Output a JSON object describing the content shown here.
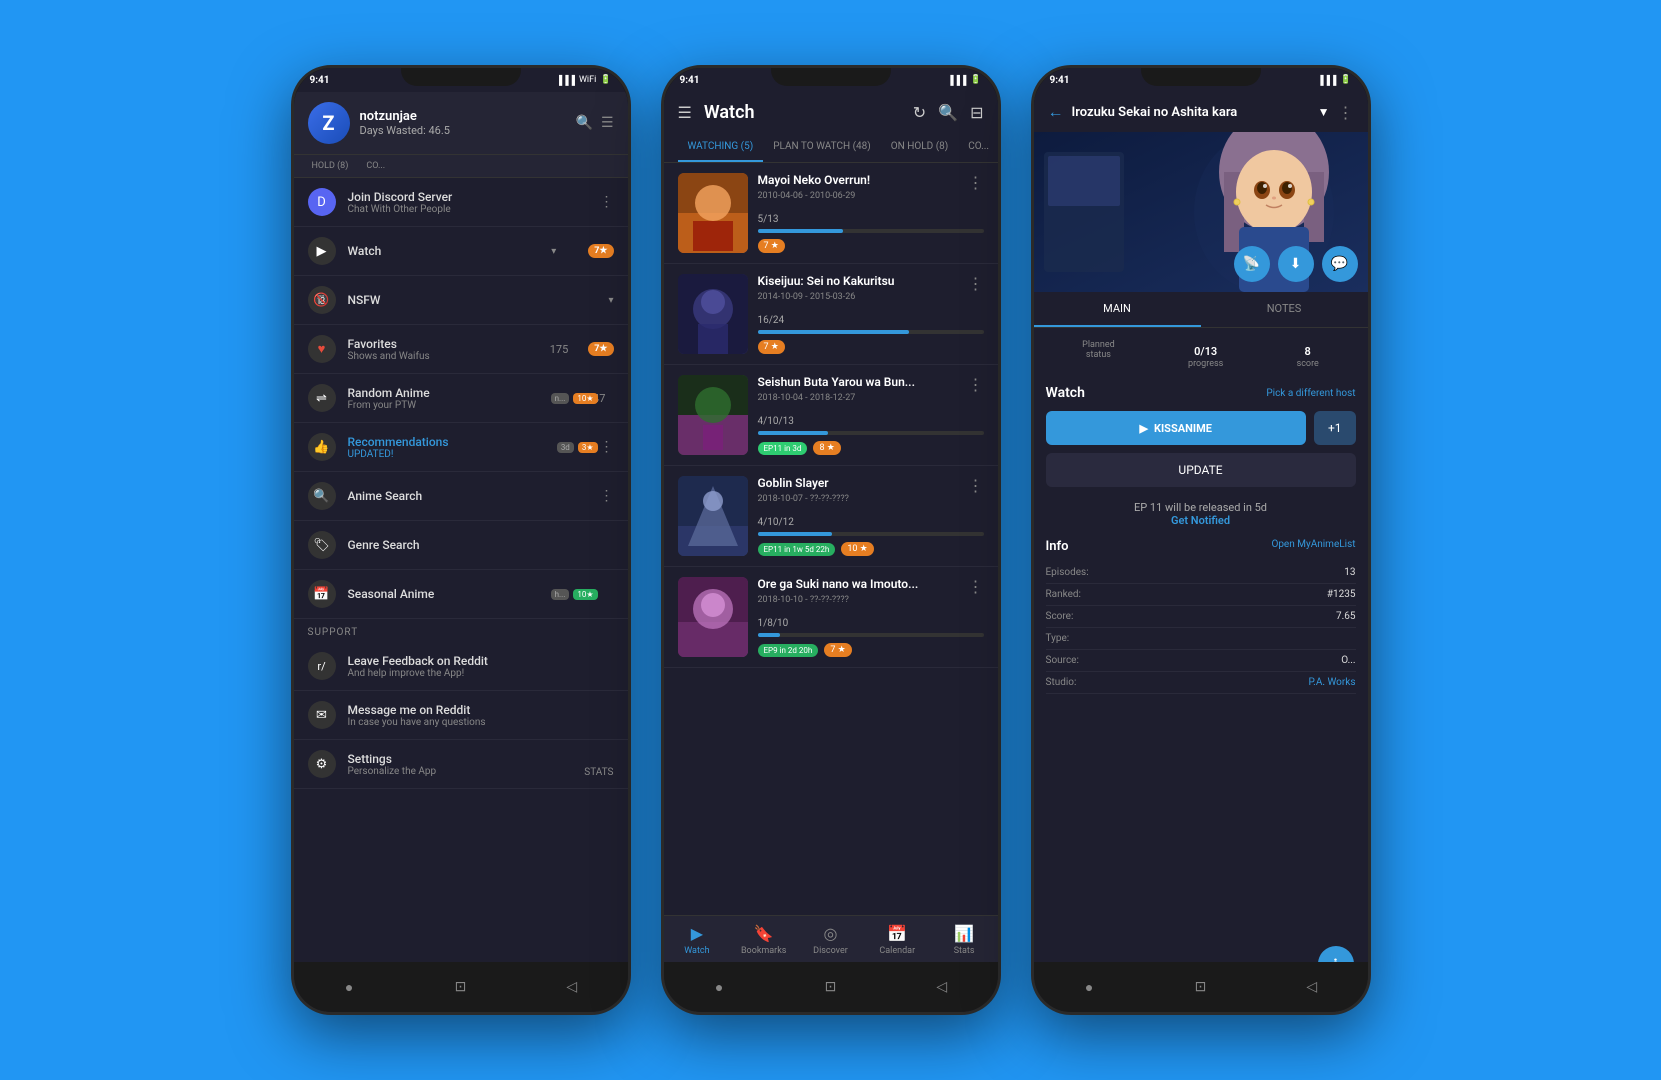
{
  "bg_color": "#2196F3",
  "phone1": {
    "header": {
      "avatar_letter": "Z",
      "username": "notzunjae",
      "days_label": "Days Wasted: 46.5"
    },
    "tabs": [
      "HOLD (8)",
      "CO..."
    ],
    "menu_items": [
      {
        "id": "discord",
        "icon_type": "discord",
        "label": "Join Discord Server",
        "sub": "Chat With Other People",
        "has_more": true
      },
      {
        "id": "watch",
        "icon_type": "watch",
        "label": "Watch",
        "has_chevron": true,
        "badge": "7★"
      },
      {
        "id": "nsfw",
        "icon_type": "nsfw",
        "label": "NSFW",
        "has_chevron": true
      },
      {
        "id": "favorites",
        "icon_type": "fav",
        "label": "Favorites",
        "sub": "Shows and Waifus",
        "count": "175",
        "badge": "7★"
      },
      {
        "id": "random",
        "icon_type": "random",
        "label": "Random Anime",
        "sub": "From your PTW",
        "count": "47",
        "mini_badges": [
          "n...",
          "10★"
        ]
      },
      {
        "id": "recommendations",
        "icon_type": "rec",
        "label": "Recommendations",
        "sub": "UPDATED!",
        "label_blue": true,
        "sub_color": "#3498db",
        "mini_badges": [
          "3d",
          "3★"
        ]
      },
      {
        "id": "anime-search",
        "icon_type": "search",
        "label": "Anime Search",
        "has_more": true
      },
      {
        "id": "genre-search",
        "icon_type": "genre",
        "label": "Genre Search"
      },
      {
        "id": "seasonal",
        "icon_type": "seasonal",
        "label": "Seasonal Anime",
        "mini_badges": [
          "h...",
          "10★"
        ]
      }
    ],
    "support_label": "Support",
    "support_items": [
      {
        "id": "reddit-feedback",
        "label": "Leave Feedback on Reddit",
        "sub": "And help improve the App!"
      },
      {
        "id": "reddit-message",
        "label": "Message me on Reddit",
        "sub": "In case you have any questions"
      }
    ],
    "settings": {
      "label": "Settings",
      "sub": "Personalize the App"
    }
  },
  "phone2": {
    "header": {
      "title": "Watch"
    },
    "tabs": [
      {
        "id": "watching",
        "label": "WATCHING (5)",
        "active": true
      },
      {
        "id": "plan",
        "label": "PLAN TO WATCH (48)",
        "active": false
      },
      {
        "id": "hold",
        "label": "ON HOLD (8)",
        "active": false
      },
      {
        "id": "completed",
        "label": "CO...",
        "active": false
      }
    ],
    "anime_list": [
      {
        "id": "mayoi",
        "title": "Mayoi Neko Overrun!",
        "dates": "2010-04-06 - 2010-06-29",
        "progress": "5/13",
        "progress_pct": 38,
        "thumb_class": "thumb-mayoi",
        "score": "7★",
        "ep_badge": null
      },
      {
        "id": "kiseijuu",
        "title": "Kiseijuu: Sei no Kakuritsu",
        "dates": "2014-10-09 - 2015-03-26",
        "progress": "16/24",
        "progress_pct": 67,
        "thumb_class": "thumb-kiseijuu",
        "score": "7★",
        "ep_badge": null
      },
      {
        "id": "seishun",
        "title": "Seishun Buta Yarou wa Bun...",
        "dates": "2018-10-04 - 2018-12-27",
        "progress": "4/10/13",
        "progress_pct": 31,
        "thumb_class": "thumb-seishun",
        "score": "8★",
        "ep_badge": "EP11 in 3d"
      },
      {
        "id": "goblin",
        "title": "Goblin Slayer",
        "dates": "2018-10-07 - ??-??-????",
        "progress": "4/10/12",
        "progress_pct": 33,
        "thumb_class": "thumb-goblin",
        "score": "10★",
        "ep_badge": "EP11 in 1w 5d 22h"
      },
      {
        "id": "ore",
        "title": "Ore ga Suki nano wa Imouto...",
        "dates": "2018-10-10 - ??-??-????",
        "progress": "1/8/10",
        "progress_pct": 10,
        "thumb_class": "thumb-ore",
        "score": "7★",
        "ep_badge": "EP9 in 2d 20h"
      }
    ],
    "nav_items": [
      {
        "id": "watch",
        "label": "Watch",
        "icon": "▶",
        "active": true
      },
      {
        "id": "bookmarks",
        "label": "Bookmarks",
        "icon": "🔖",
        "active": false
      },
      {
        "id": "discover",
        "label": "Discover",
        "icon": "◎",
        "active": false
      },
      {
        "id": "calendar",
        "label": "Calendar",
        "icon": "📅",
        "active": false
      },
      {
        "id": "stats",
        "label": "Stats",
        "icon": "📊",
        "active": false
      }
    ]
  },
  "phone3": {
    "header": {
      "title": "Irozuku Sekai no Ashita kara",
      "dropdown": "▼"
    },
    "tabs": [
      {
        "id": "main",
        "label": "MAIN",
        "active": true
      },
      {
        "id": "notes",
        "label": "NOTES",
        "active": false
      }
    ],
    "stats": [
      {
        "label": "Planned status",
        "value": "Planned"
      },
      {
        "label": "progress",
        "value": "0/13"
      },
      {
        "label": "score",
        "value": "8"
      }
    ],
    "watch_section": {
      "title": "Watch",
      "host_label": "Pick a different host",
      "kissanime_label": "KISSANIME",
      "plus_label": "+1",
      "update_label": "UPDATE"
    },
    "notification": {
      "text": "EP 11 will be released in 5d",
      "link": "Get Notified"
    },
    "info": {
      "title": "Info",
      "mal_link": "Open MyAnimeList",
      "rows": [
        {
          "key": "Episodes:",
          "value": "13"
        },
        {
          "key": "Ranked:",
          "value": "#1235"
        },
        {
          "key": "Score:",
          "value": "7.65"
        },
        {
          "key": "Type:",
          "value": ""
        },
        {
          "key": "Source:",
          "value": "O..."
        },
        {
          "key": "Studio:",
          "value": "P.A. Works",
          "blue": true
        }
      ]
    }
  }
}
